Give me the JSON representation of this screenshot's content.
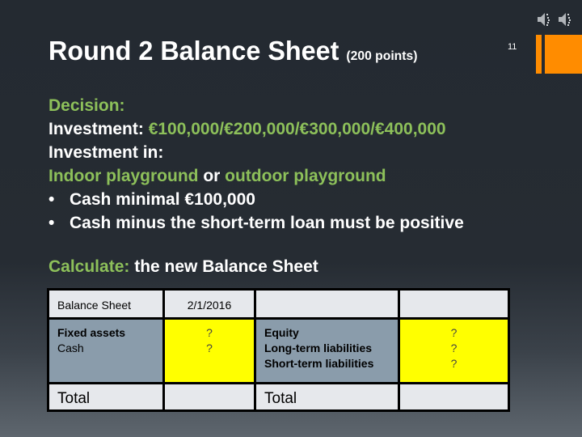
{
  "slide": {
    "title": "Round 2 Balance  Sheet ",
    "title_points": "(200 points)",
    "slide_number": "11",
    "icons": [
      "speaker-icon",
      "speaker-icon"
    ]
  },
  "content": {
    "decision_label": "Decision:",
    "investment_label": "Investment: ",
    "investment_values": "€100,000/€200,000/€300,000/€400,000",
    "investment_in_label": "Investment in:",
    "option_indoor": "Indoor playground",
    "option_or": " or ",
    "option_outdoor": "outdoor playground",
    "bullets": [
      "Cash minimal €100,000",
      "Cash minus the short-term loan must be positive"
    ],
    "bullet_glyph": "•",
    "calculate_label": "Calculate:",
    "calculate_text": " the new Balance Sheet"
  },
  "balance_sheet": {
    "header": {
      "title": "Balance Sheet",
      "date": "2/1/2016",
      "col3": "",
      "col4": ""
    },
    "assets": {
      "labels": [
        "Fixed assets",
        "Cash"
      ],
      "values": [
        "?",
        "?"
      ]
    },
    "liabilities": {
      "labels": [
        "Equity",
        "Long-term liabilities",
        "Short-term liabilities"
      ],
      "values": [
        "?",
        "?",
        "?"
      ]
    },
    "totals": {
      "left_label": "Total",
      "left_value": "",
      "right_label": "Total",
      "right_value": ""
    }
  },
  "colors": {
    "accent_green": "#8dc05a",
    "accent_orange": "#ff8c00",
    "cell_yellow": "#ffff00",
    "cell_slate": "#8a9cab",
    "cell_light": "#e6e8ec"
  }
}
